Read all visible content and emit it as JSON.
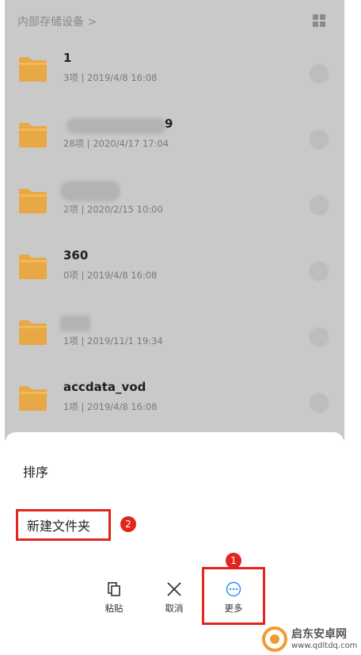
{
  "breadcrumb": "内部存储设备 >",
  "folders": [
    {
      "name": "1",
      "meta": "3项 | 2019/4/8 16:08"
    },
    {
      "name": "9",
      "meta": "28项 | 2020/4/17 17:04"
    },
    {
      "name": "",
      "meta": "2项 | 2020/2/15 10:00"
    },
    {
      "name": "360",
      "meta": "0项 | 2019/4/8 16:08"
    },
    {
      "name": "",
      "meta": "1项 | 2019/11/1 19:34"
    },
    {
      "name": "accdata_vod",
      "meta": "1项 | 2019/4/8 16:08"
    }
  ],
  "sheet": {
    "sort_label": "排序",
    "new_folder_label": "新建文件夹",
    "new_folder_step": "2",
    "more_step": "1",
    "toolbar": {
      "paste_label": "粘贴",
      "cancel_label": "取消",
      "more_label": "更多"
    }
  },
  "colors": {
    "folder": "#e7a845",
    "accent_red": "#e0261d",
    "accent_blue": "#2f8ef4"
  },
  "watermark": {
    "line1": "启东安卓网",
    "line2": "www.qdltdq.com"
  }
}
